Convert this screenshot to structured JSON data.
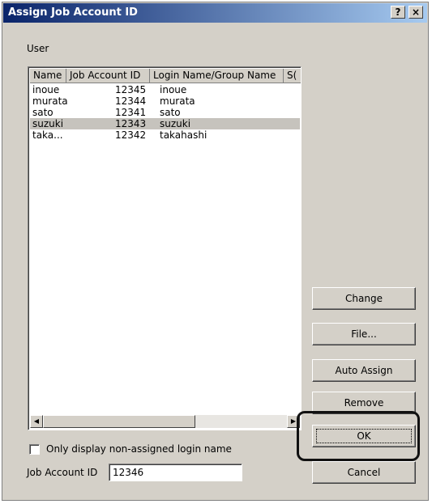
{
  "window": {
    "title": "Assign Job Account ID",
    "help_label": "?",
    "close_label": "×"
  },
  "user_group_label": "User",
  "list": {
    "columns": [
      "Name",
      "Job Account ID",
      "Login Name/Group Name",
      "S("
    ],
    "rows": [
      {
        "name": "inoue",
        "id": "12345",
        "login": "inoue",
        "selected": false
      },
      {
        "name": "murata",
        "id": "12344",
        "login": "murata",
        "selected": false
      },
      {
        "name": "sato",
        "id": "12341",
        "login": "sato",
        "selected": false
      },
      {
        "name": "suzuki",
        "id": "12343",
        "login": "suzuki",
        "selected": true
      },
      {
        "name": "taka...",
        "id": "12342",
        "login": "takahashi",
        "selected": false
      }
    ]
  },
  "buttons": {
    "change": "Change",
    "file": "File...",
    "auto_assign": "Auto Assign",
    "remove": "Remove",
    "ok": "OK",
    "cancel": "Cancel"
  },
  "checkbox_label": "Only display non-assigned login name",
  "checkbox_checked": false,
  "job_account_field": {
    "label": "Job Account ID",
    "value": "12346"
  }
}
